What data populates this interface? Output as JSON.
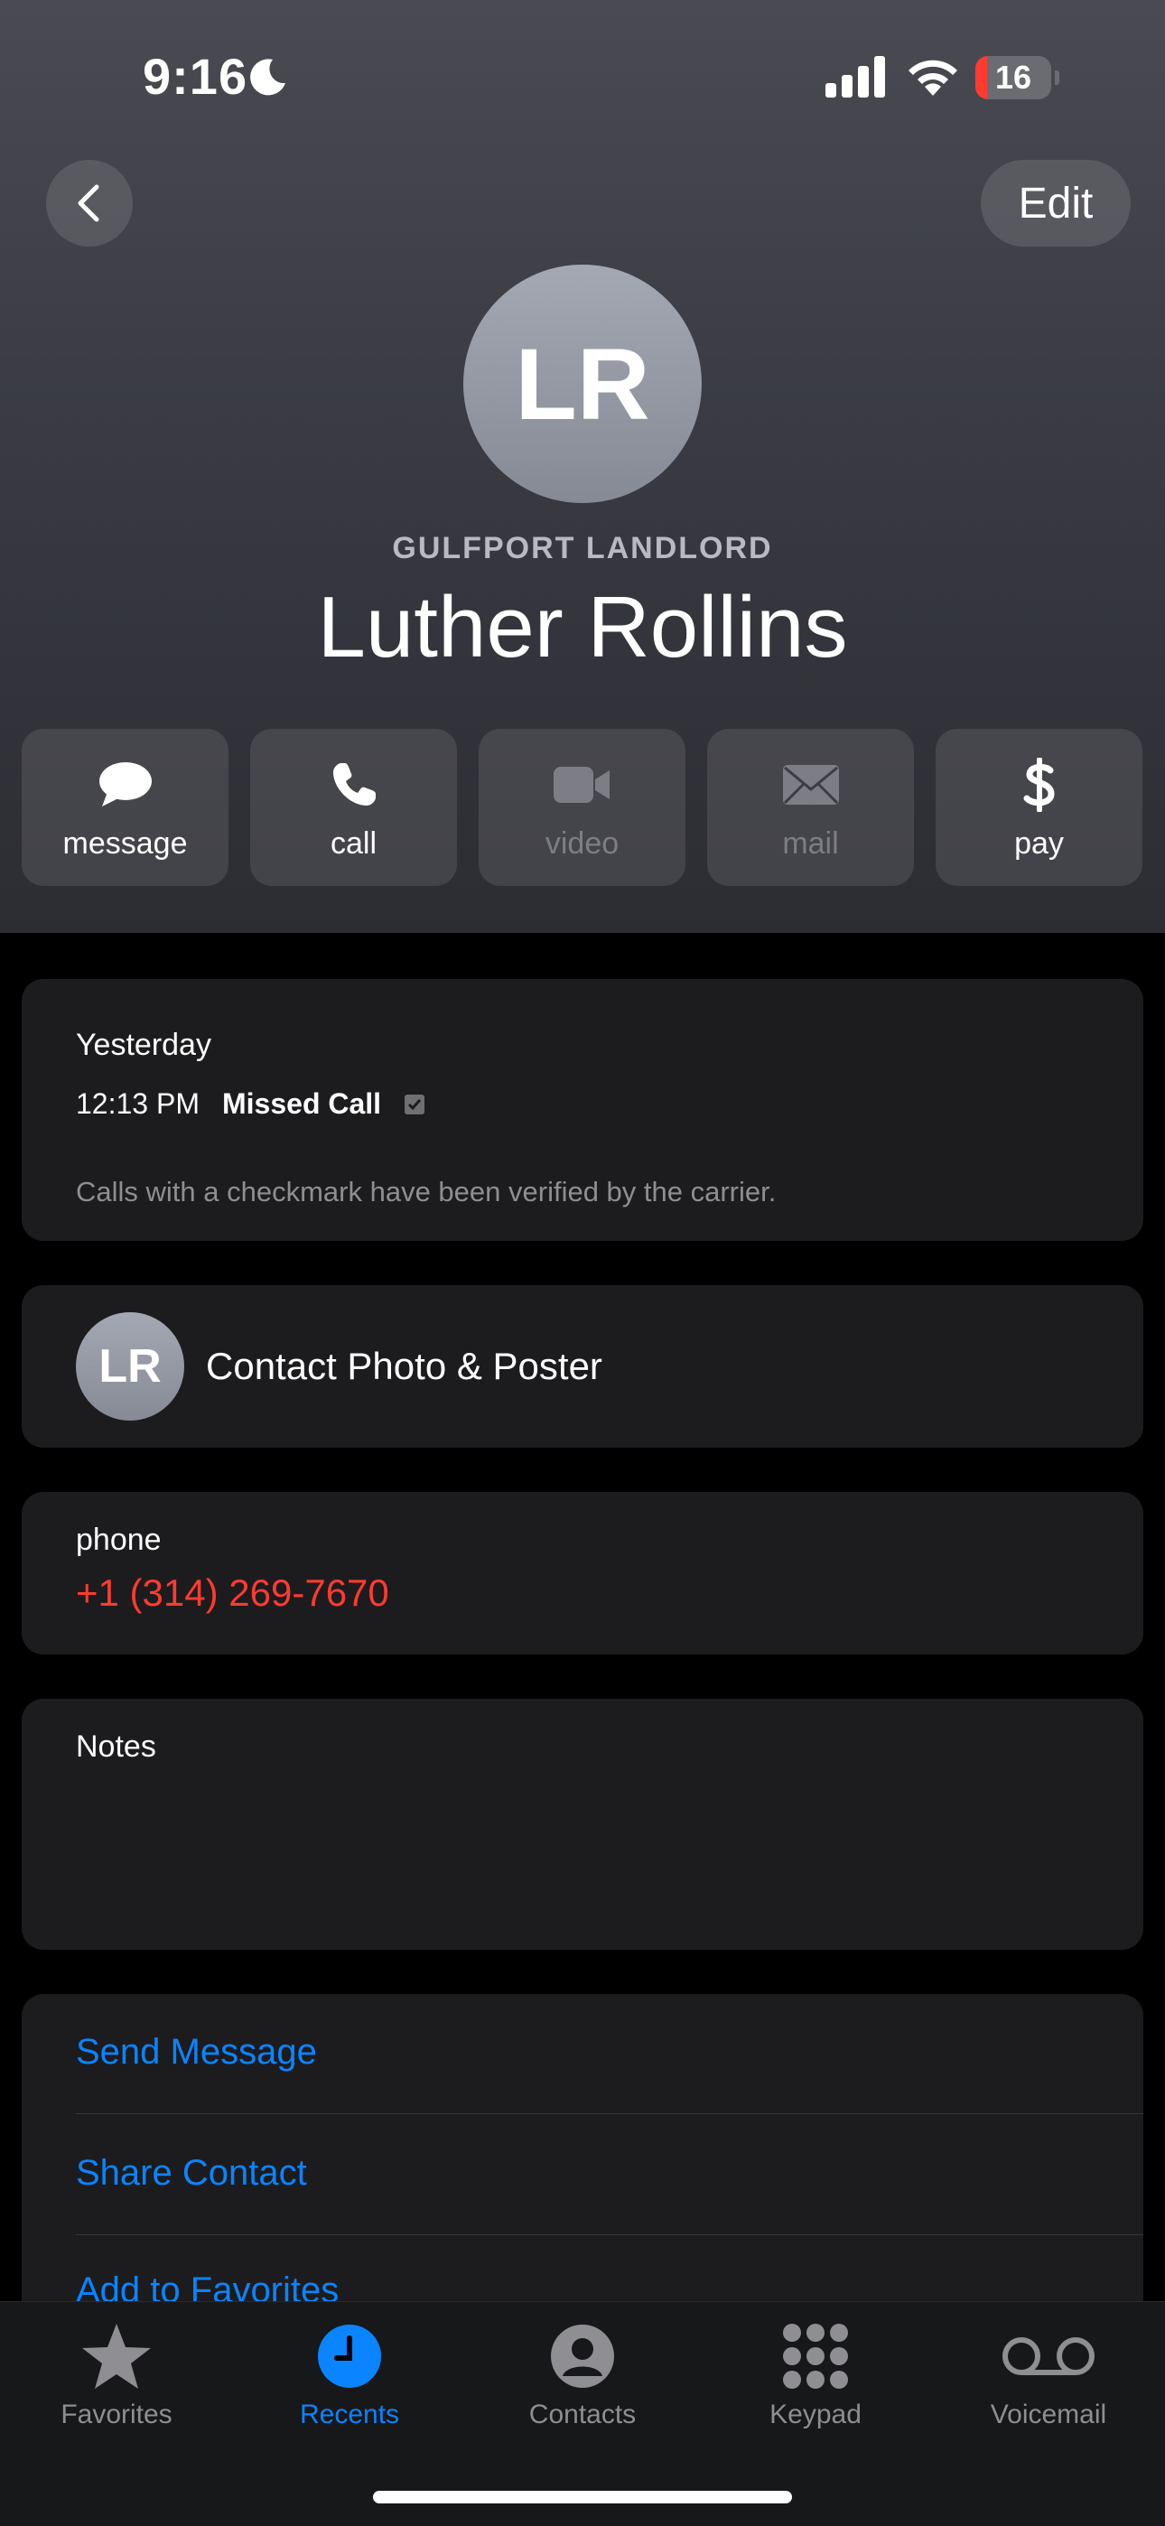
{
  "status": {
    "time": "9:16",
    "battery": "16",
    "battery_level": 0.16
  },
  "nav": {
    "edit_label": "Edit"
  },
  "contact": {
    "initials": "LR",
    "subtitle": "GULFPORT LANDLORD",
    "name": "Luther Rollins"
  },
  "actions": [
    {
      "label": "message",
      "icon": "message-icon",
      "enabled": true
    },
    {
      "label": "call",
      "icon": "phone-icon",
      "enabled": true
    },
    {
      "label": "video",
      "icon": "video-icon",
      "enabled": false
    },
    {
      "label": "mail",
      "icon": "mail-icon",
      "enabled": false
    },
    {
      "label": "pay",
      "icon": "dollar-icon",
      "enabled": true
    }
  ],
  "recent_call": {
    "day": "Yesterday",
    "time": "12:13 PM",
    "type": "Missed Call",
    "note": "Calls with a checkmark have been verified by the carrier."
  },
  "poster": {
    "initials": "LR",
    "label": "Contact Photo & Poster"
  },
  "phone": {
    "label": "phone",
    "number": "+1 (314) 269-7670"
  },
  "notes": {
    "label": "Notes",
    "value": ""
  },
  "links": [
    "Send Message",
    "Share Contact",
    "Add to Favorites"
  ],
  "tabs": [
    {
      "label": "Favorites",
      "icon": "star-icon",
      "active": false
    },
    {
      "label": "Recents",
      "icon": "clock-icon",
      "active": true
    },
    {
      "label": "Contacts",
      "icon": "person-icon",
      "active": false
    },
    {
      "label": "Keypad",
      "icon": "keypad-icon",
      "active": false
    },
    {
      "label": "Voicemail",
      "icon": "voicemail-icon",
      "active": false
    }
  ],
  "colors": {
    "accent": "#0a84ff",
    "missed": "#ff3b30",
    "card": "#1c1c1e",
    "disabled": "#7d7e85"
  }
}
